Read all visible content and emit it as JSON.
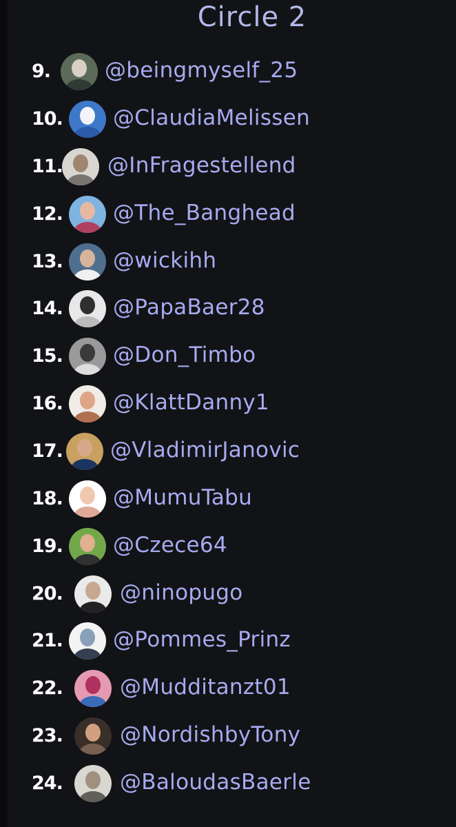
{
  "title": "Circle 2",
  "entries": [
    {
      "rank": "9.",
      "handle": "@beingmyself_25",
      "avatar": "avatar-icon"
    },
    {
      "rank": "10.",
      "handle": "@ClaudiaMelissen",
      "avatar": "avatar-icon"
    },
    {
      "rank": "11.",
      "handle": "@InFragestellend",
      "avatar": "avatar-icon"
    },
    {
      "rank": "12.",
      "handle": "@The_Banghead",
      "avatar": "avatar-icon"
    },
    {
      "rank": "13.",
      "handle": "@wickihh",
      "avatar": "avatar-icon"
    },
    {
      "rank": "14.",
      "handle": "@PapaBaer28",
      "avatar": "avatar-icon"
    },
    {
      "rank": "15.",
      "handle": "@Don_Timbo",
      "avatar": "avatar-icon"
    },
    {
      "rank": "16.",
      "handle": "@KlattDanny1",
      "avatar": "avatar-icon"
    },
    {
      "rank": "17.",
      "handle": "@VladimirJanovic",
      "avatar": "avatar-icon"
    },
    {
      "rank": "18.",
      "handle": "@MumuTabu",
      "avatar": "avatar-icon"
    },
    {
      "rank": "19.",
      "handle": "@Czece64",
      "avatar": "avatar-icon"
    },
    {
      "rank": "20.",
      "handle": "@ninopugo",
      "avatar": "avatar-icon"
    },
    {
      "rank": "21.",
      "handle": "@Pommes_Prinz",
      "avatar": "avatar-icon"
    },
    {
      "rank": "22.",
      "handle": "@Mudditanzt01",
      "avatar": "avatar-icon"
    },
    {
      "rank": "23.",
      "handle": "@NordishbyTony",
      "avatar": "avatar-icon"
    },
    {
      "rank": "24.",
      "handle": "@BaloudasBaerle",
      "avatar": "avatar-icon"
    }
  ],
  "colors": {
    "background": "#121316",
    "title": "#b2b7e8",
    "handle": "#a6abf0",
    "rank": "#ffffff"
  }
}
